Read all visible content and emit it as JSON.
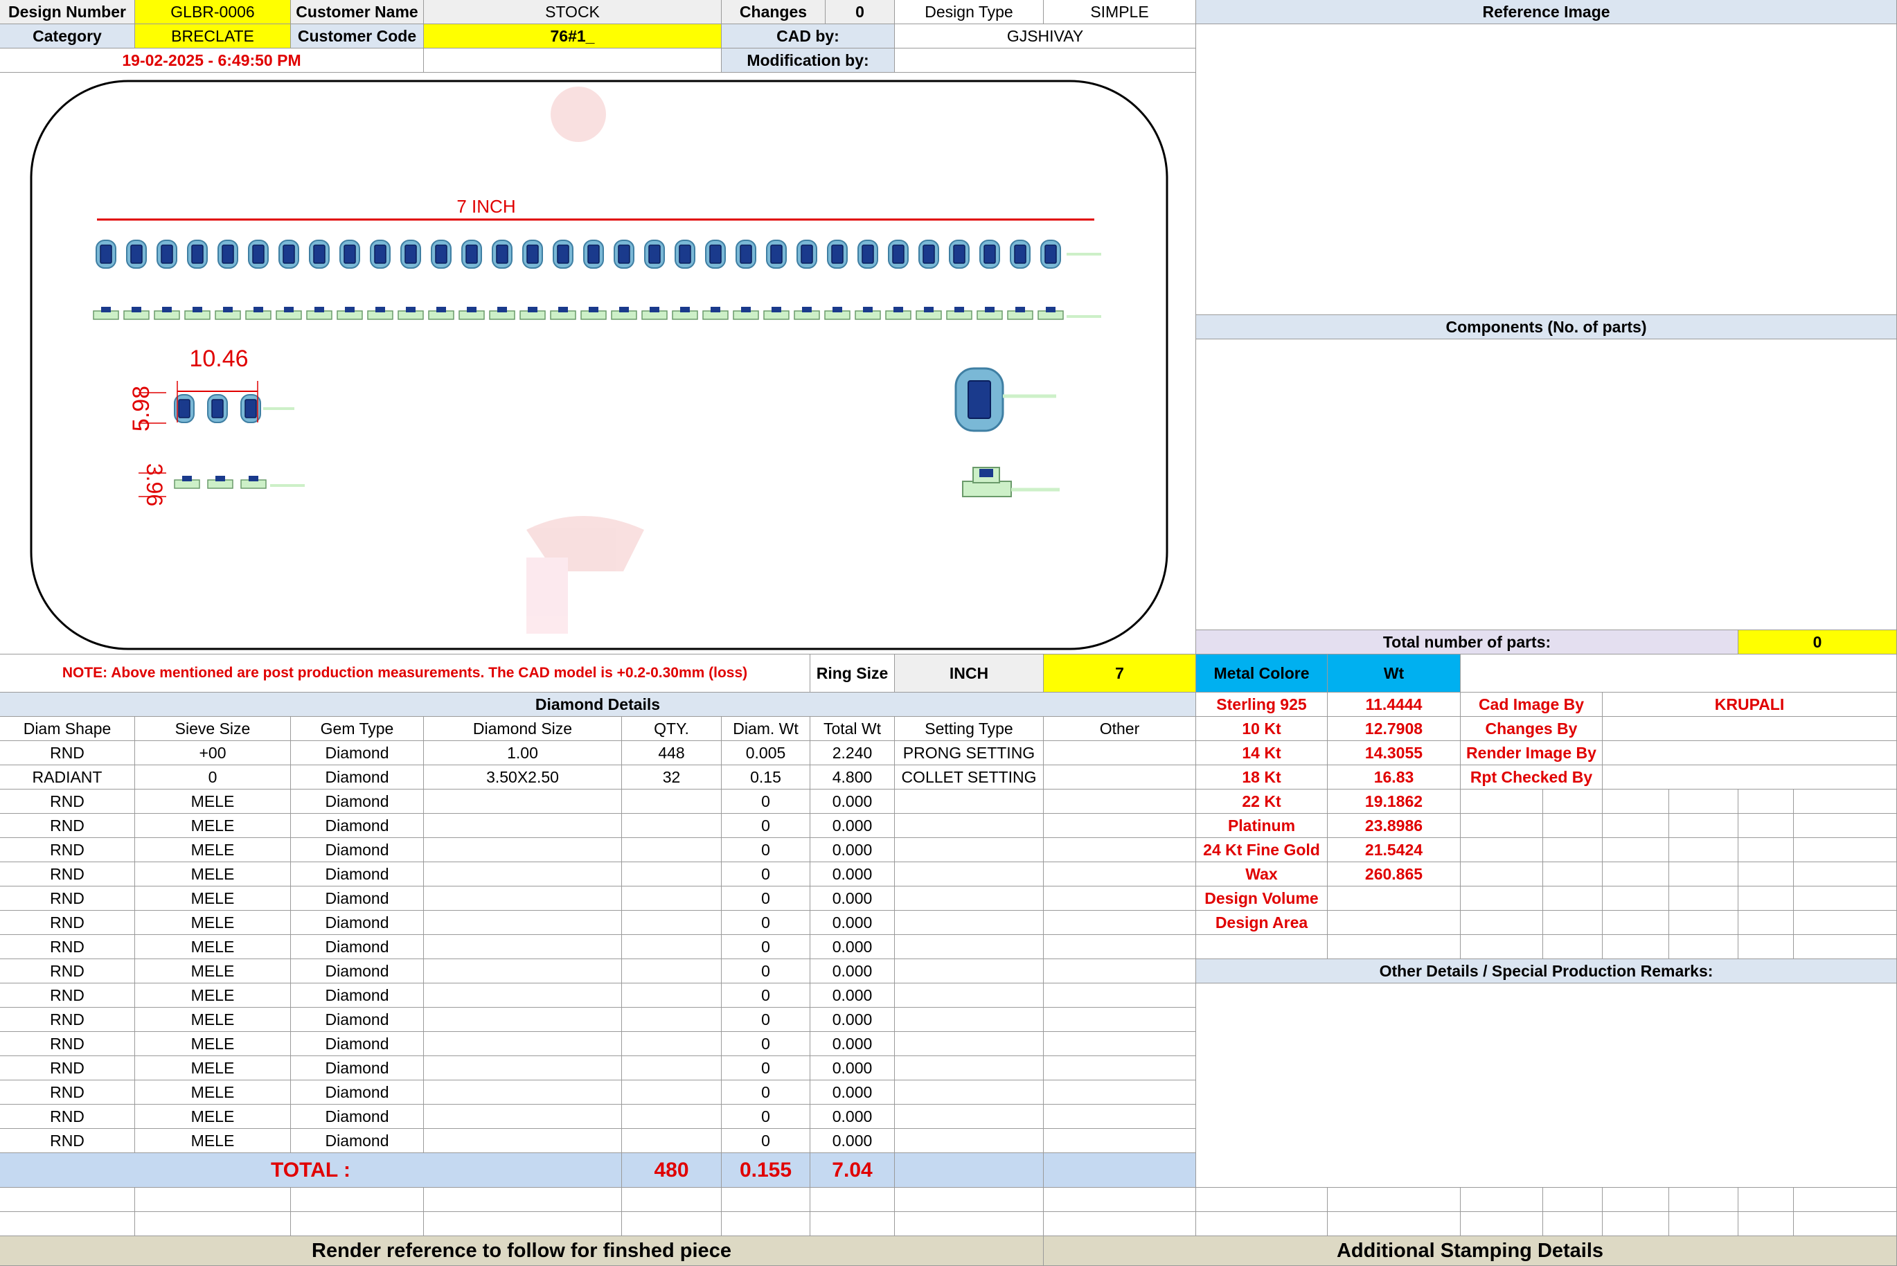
{
  "header": {
    "design_number_label": "Design Number",
    "design_number": "GLBR-0006",
    "customer_name_label": "Customer Name",
    "customer_name": "STOCK",
    "changes_label": "Changes",
    "changes": "0",
    "design_type_label": "Design Type",
    "design_type": "SIMPLE",
    "reference_image_label": "Reference Image",
    "category_label": "Category",
    "category": "BRECLATE",
    "customer_code_label": "Customer Code",
    "customer_code": "76#1_",
    "cad_by_label": "CAD by:",
    "cad_by": "GJSHIVAY",
    "timestamp": "19-02-2025 - 6:49:50 PM",
    "modification_by_label": "Modification by:",
    "modification_by": ""
  },
  "drawing": {
    "length_label": "7 INCH",
    "dim_width": "10.46",
    "dim_height": "5.98",
    "dim_depth": "3.96"
  },
  "components": {
    "label": "Components (No. of parts)",
    "total_parts_label": "Total number of parts:",
    "total_parts": "0"
  },
  "note": "NOTE: Above mentioned are post production measurements. The CAD model is +0.2-0.30mm (loss)",
  "ring_size": {
    "label": "Ring Size",
    "unit": "INCH",
    "value": "7"
  },
  "metal": {
    "colore_label": "Metal Colore",
    "wt_label": "Wt",
    "rows": [
      {
        "name": "Sterling 925",
        "wt": "11.4444",
        "by_label": "Cad Image By",
        "by_value": "KRUPALI"
      },
      {
        "name": "10 Kt",
        "wt": "12.7908",
        "by_label": "Changes By",
        "by_value": ""
      },
      {
        "name": "14 Kt",
        "wt": "14.3055",
        "by_label": "Render Image By",
        "by_value": ""
      },
      {
        "name": "18 Kt",
        "wt": "16.83",
        "by_label": "Rpt Checked By",
        "by_value": ""
      },
      {
        "name": "22 Kt",
        "wt": "19.1862"
      },
      {
        "name": "Platinum",
        "wt": "23.8986"
      },
      {
        "name": "24 Kt Fine Gold",
        "wt": "21.5424"
      },
      {
        "name": "Wax",
        "wt": "260.865"
      },
      {
        "name": "Design Volume",
        "wt": ""
      },
      {
        "name": "Design Area",
        "wt": ""
      }
    ]
  },
  "other_details_label": "Other Details / Special Production Remarks:",
  "diamond": {
    "title": "Diamond Details",
    "columns": [
      "Diam Shape",
      "Sieve Size",
      "Gem Type",
      "Diamond Size",
      "QTY.",
      "Diam. Wt",
      "Total Wt",
      "Setting Type",
      "Other"
    ],
    "rows": [
      [
        "RND",
        "+00",
        "Diamond",
        "1.00",
        "448",
        "0.005",
        "2.240",
        "PRONG SETTING",
        ""
      ],
      [
        "RADIANT",
        "0",
        "Diamond",
        "3.50X2.50",
        "32",
        "0.15",
        "4.800",
        "COLLET SETTING",
        ""
      ],
      [
        "RND",
        "MELE",
        "Diamond",
        "",
        "",
        "0",
        "0.000",
        "",
        ""
      ],
      [
        "RND",
        "MELE",
        "Diamond",
        "",
        "",
        "0",
        "0.000",
        "",
        ""
      ],
      [
        "RND",
        "MELE",
        "Diamond",
        "",
        "",
        "0",
        "0.000",
        "",
        ""
      ],
      [
        "RND",
        "MELE",
        "Diamond",
        "",
        "",
        "0",
        "0.000",
        "",
        ""
      ],
      [
        "RND",
        "MELE",
        "Diamond",
        "",
        "",
        "0",
        "0.000",
        "",
        ""
      ],
      [
        "RND",
        "MELE",
        "Diamond",
        "",
        "",
        "0",
        "0.000",
        "",
        ""
      ],
      [
        "RND",
        "MELE",
        "Diamond",
        "",
        "",
        "0",
        "0.000",
        "",
        ""
      ],
      [
        "RND",
        "MELE",
        "Diamond",
        "",
        "",
        "0",
        "0.000",
        "",
        ""
      ],
      [
        "RND",
        "MELE",
        "Diamond",
        "",
        "",
        "0",
        "0.000",
        "",
        ""
      ],
      [
        "RND",
        "MELE",
        "Diamond",
        "",
        "",
        "0",
        "0.000",
        "",
        ""
      ],
      [
        "RND",
        "MELE",
        "Diamond",
        "",
        "",
        "0",
        "0.000",
        "",
        ""
      ],
      [
        "RND",
        "MELE",
        "Diamond",
        "",
        "",
        "0",
        "0.000",
        "",
        ""
      ],
      [
        "RND",
        "MELE",
        "Diamond",
        "",
        "",
        "0",
        "0.000",
        "",
        ""
      ],
      [
        "RND",
        "MELE",
        "Diamond",
        "",
        "",
        "0",
        "0.000",
        "",
        ""
      ],
      [
        "RND",
        "MELE",
        "Diamond",
        "",
        "",
        "0",
        "0.000",
        "",
        ""
      ]
    ],
    "total_label": "TOTAL :",
    "total_qty": "480",
    "total_diam_wt": "0.155",
    "total_wt": "7.04"
  },
  "footer": {
    "render_reference": "Render reference to follow for finshed piece",
    "stamping": "Additional Stamping Details"
  },
  "colors": {
    "yellow": "#ffff00",
    "header_blue": "#dbe5f1",
    "cyan": "#00b0f0",
    "red_text": "#e00000",
    "stone_blue": "#1a3a8c",
    "halo": "#7ab8d6",
    "metal_green": "#cdf0c8"
  }
}
